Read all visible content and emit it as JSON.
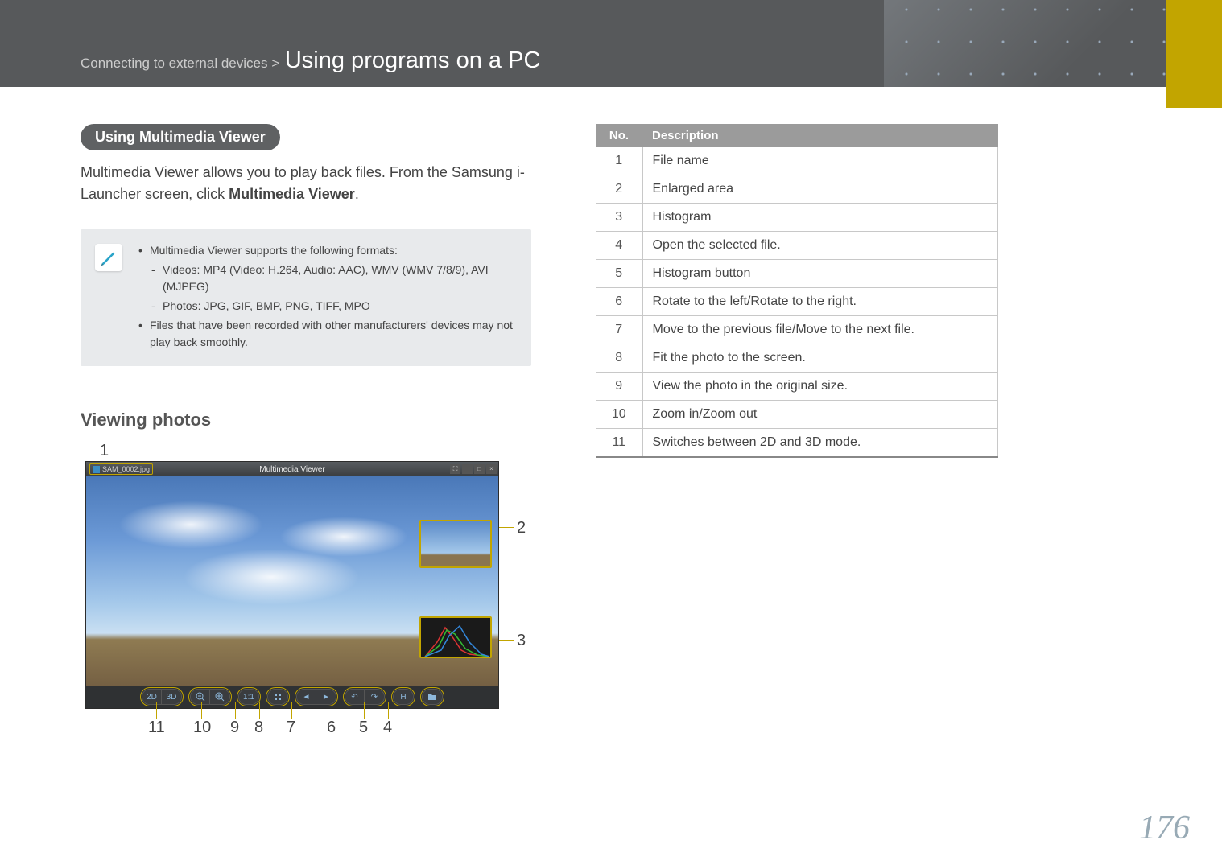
{
  "header": {
    "breadcrumb_parent": "Connecting to external devices >",
    "breadcrumb_main": "Using programs on a PC"
  },
  "left": {
    "pill": "Using Multimedia Viewer",
    "intro_1": "Multimedia Viewer allows you to play back files. From the Samsung i-Launcher screen, click ",
    "intro_bold": "Multimedia Viewer",
    "intro_2": ".",
    "note": {
      "line1": "Multimedia Viewer supports the following formats:",
      "sub1": "Videos: MP4 (Video: H.264, Audio: AAC), WMV (WMV 7/8/9), AVI (MJPEG)",
      "sub2": "Photos: JPG, GIF, BMP, PNG, TIFF, MPO",
      "line2": "Files that have been recorded with other manufacturers' devices may not play back smoothly."
    },
    "subheading": "Viewing photos",
    "viewer": {
      "filename": "SAM_0002.jpg",
      "app_title": "Multimedia Viewer",
      "btn_2d": "2D",
      "btn_3d": "3D",
      "btn_11": "1:1",
      "callouts": [
        "1",
        "2",
        "3",
        "4",
        "5",
        "6",
        "7",
        "8",
        "9",
        "10",
        "11"
      ]
    }
  },
  "table": {
    "header_no": "No.",
    "header_desc": "Description",
    "rows": [
      {
        "no": "1",
        "desc": "File name"
      },
      {
        "no": "2",
        "desc": "Enlarged area"
      },
      {
        "no": "3",
        "desc": "Histogram"
      },
      {
        "no": "4",
        "desc": "Open the selected file."
      },
      {
        "no": "5",
        "desc": "Histogram button"
      },
      {
        "no": "6",
        "desc": "Rotate to the left/Rotate to the right."
      },
      {
        "no": "7",
        "desc": "Move to the previous file/Move to the next file."
      },
      {
        "no": "8",
        "desc": "Fit the photo to the screen."
      },
      {
        "no": "9",
        "desc": "View the photo in the original size."
      },
      {
        "no": "10",
        "desc": "Zoom in/Zoom out"
      },
      {
        "no": "11",
        "desc": "Switches between 2D and 3D mode."
      }
    ]
  },
  "page_number": "176"
}
